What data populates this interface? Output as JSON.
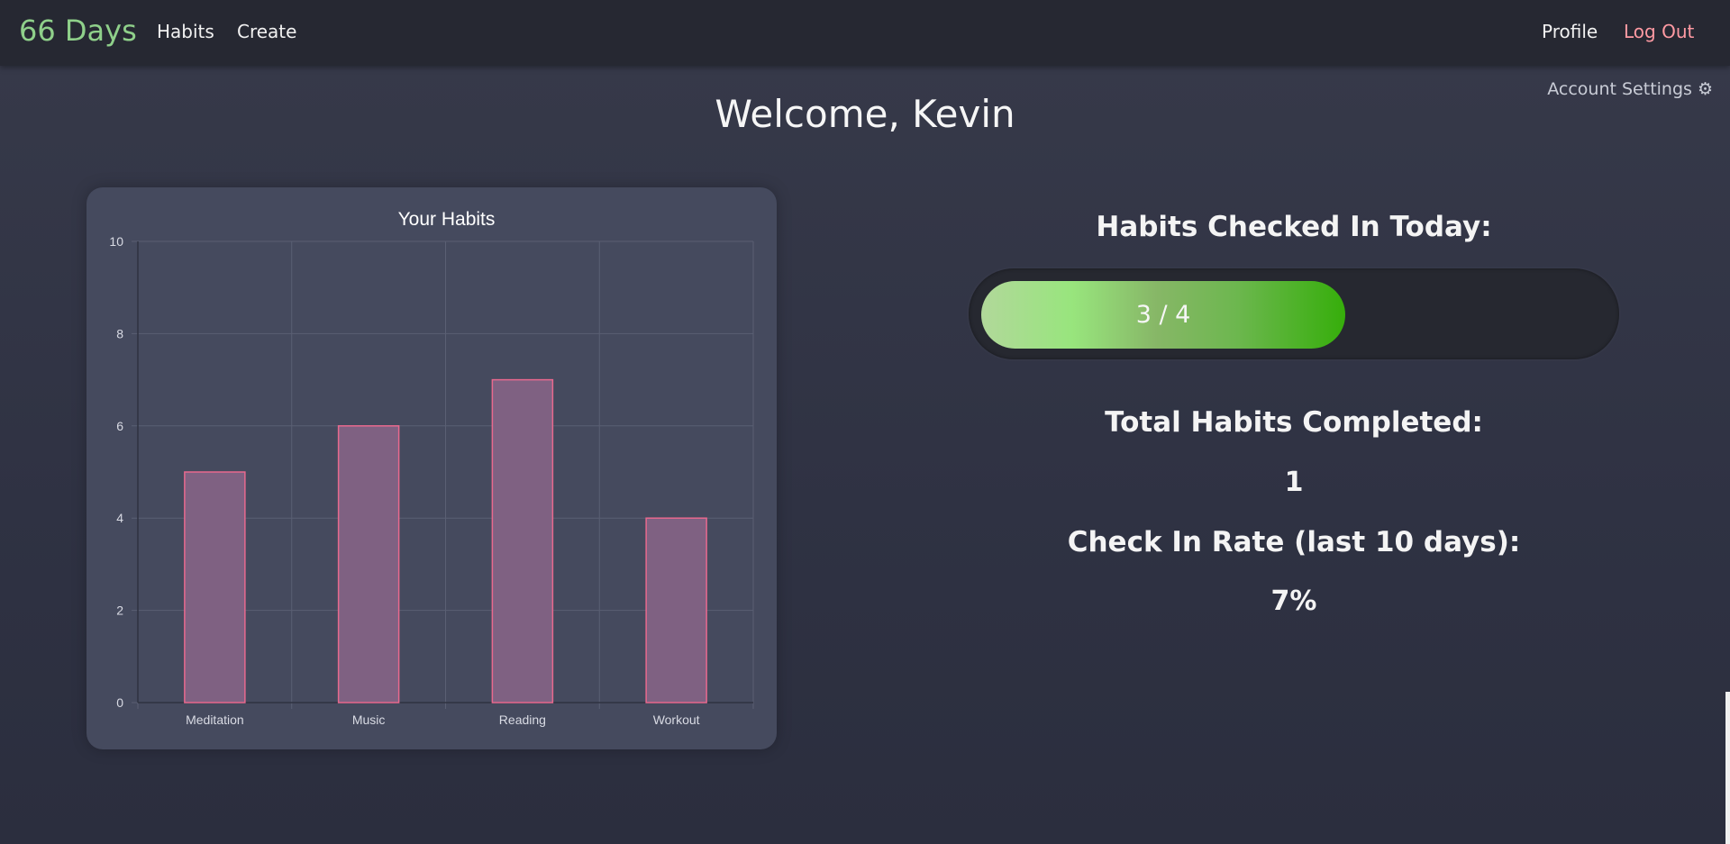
{
  "nav": {
    "brand": "66 Days",
    "links": [
      "Habits",
      "Create"
    ],
    "profile": "Profile",
    "logout": "Log Out"
  },
  "account_settings": "Account Settings ⚙",
  "welcome": "Welcome, Kevin",
  "stats": {
    "checked_in_heading": "Habits Checked In Today:",
    "checked_in_label": "3 / 4",
    "checked_in_done": 3,
    "checked_in_total": 4,
    "total_heading": "Total Habits Completed:",
    "total_value": "1",
    "rate_heading": "Check In Rate (last 10 days):",
    "rate_value": "7%"
  },
  "colors": {
    "brand": "#8fd08a",
    "logout": "#ff9aa3",
    "bar_fill": "#7f6182",
    "bar_stroke": "#e8698e"
  },
  "chart_data": {
    "type": "bar",
    "title": "Your Habits",
    "categories": [
      "Meditation",
      "Music",
      "Reading",
      "Workout"
    ],
    "values": [
      5,
      6,
      7,
      4
    ],
    "ylim": [
      0,
      10
    ],
    "yticks": [
      0,
      2,
      4,
      6,
      8,
      10
    ],
    "grid": true,
    "legend": "none"
  }
}
